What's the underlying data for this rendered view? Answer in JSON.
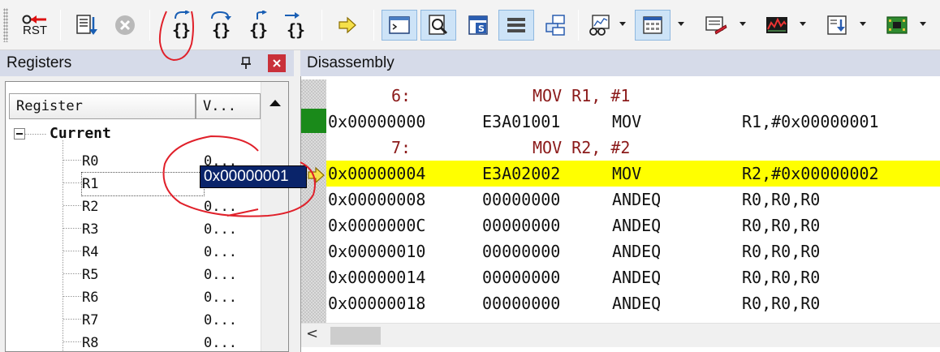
{
  "toolbar": {
    "rst_label": "RST",
    "step_in_label": "{}",
    "step_over_label": "{}",
    "step_out_label": "{}",
    "run_to_cursor_label": "{}"
  },
  "registers_panel": {
    "title": "Registers",
    "pin_glyph": "📌",
    "close_glyph": "×",
    "columns": [
      "Register",
      "V..."
    ],
    "group_label": "Current",
    "rows": [
      {
        "name": "R0",
        "value": "0..."
      },
      {
        "name": "R1",
        "value": "0x00000001"
      },
      {
        "name": "R2",
        "value": "0..."
      },
      {
        "name": "R3",
        "value": "0..."
      },
      {
        "name": "R4",
        "value": "0..."
      },
      {
        "name": "R5",
        "value": "0..."
      },
      {
        "name": "R6",
        "value": "0..."
      },
      {
        "name": "R7",
        "value": "0..."
      },
      {
        "name": "R8",
        "value": "0..."
      }
    ]
  },
  "disassembly_panel": {
    "title": "Disassembly",
    "lines": [
      {
        "kind": "source",
        "lineno": "6:",
        "source": "MOV R1, #1"
      },
      {
        "kind": "asm",
        "addr": "0x00000000",
        "opcode": "E3A01001",
        "mnemonic": "MOV",
        "operands": "R1,#0x00000001"
      },
      {
        "kind": "source",
        "lineno": "7:",
        "source": "MOV R2, #2"
      },
      {
        "kind": "asm",
        "addr": "0x00000004",
        "opcode": "E3A02002",
        "mnemonic": "MOV",
        "operands": "R2,#0x00000002",
        "current": true
      },
      {
        "kind": "asm",
        "addr": "0x00000008",
        "opcode": "00000000",
        "mnemonic": "ANDEQ",
        "operands": "R0,R0,R0"
      },
      {
        "kind": "asm",
        "addr": "0x0000000C",
        "opcode": "00000000",
        "mnemonic": "ANDEQ",
        "operands": "R0,R0,R0"
      },
      {
        "kind": "asm",
        "addr": "0x00000010",
        "opcode": "00000000",
        "mnemonic": "ANDEQ",
        "operands": "R0,R0,R0"
      },
      {
        "kind": "asm",
        "addr": "0x00000014",
        "opcode": "00000000",
        "mnemonic": "ANDEQ",
        "operands": "R0,R0,R0"
      },
      {
        "kind": "asm",
        "addr": "0x00000018",
        "opcode": "00000000",
        "mnemonic": "ANDEQ",
        "operands": "R0,R0,R0"
      }
    ],
    "scroll_left_glyph": "<"
  },
  "colors": {
    "current_line": "#ffff00",
    "source_text": "#8b1a1a",
    "exec_marker": "#1a8a1a",
    "edit_highlight": "#0a246a",
    "annotation": "#e0202a"
  },
  "icons": [
    "rst-icon",
    "reset-view-icon",
    "stop-icon",
    "step-into-icon",
    "step-over-icon",
    "step-out-icon",
    "run-to-cursor-icon",
    "show-next-statement-icon",
    "command-window-icon",
    "disassembly-window-icon",
    "symbols-window-icon",
    "registers-window-icon",
    "call-stack-icon",
    "watch-window-icon",
    "memory-window-icon",
    "serial-window-icon",
    "analysis-window-icon",
    "trace-window-icon",
    "system-viewer-icon"
  ]
}
